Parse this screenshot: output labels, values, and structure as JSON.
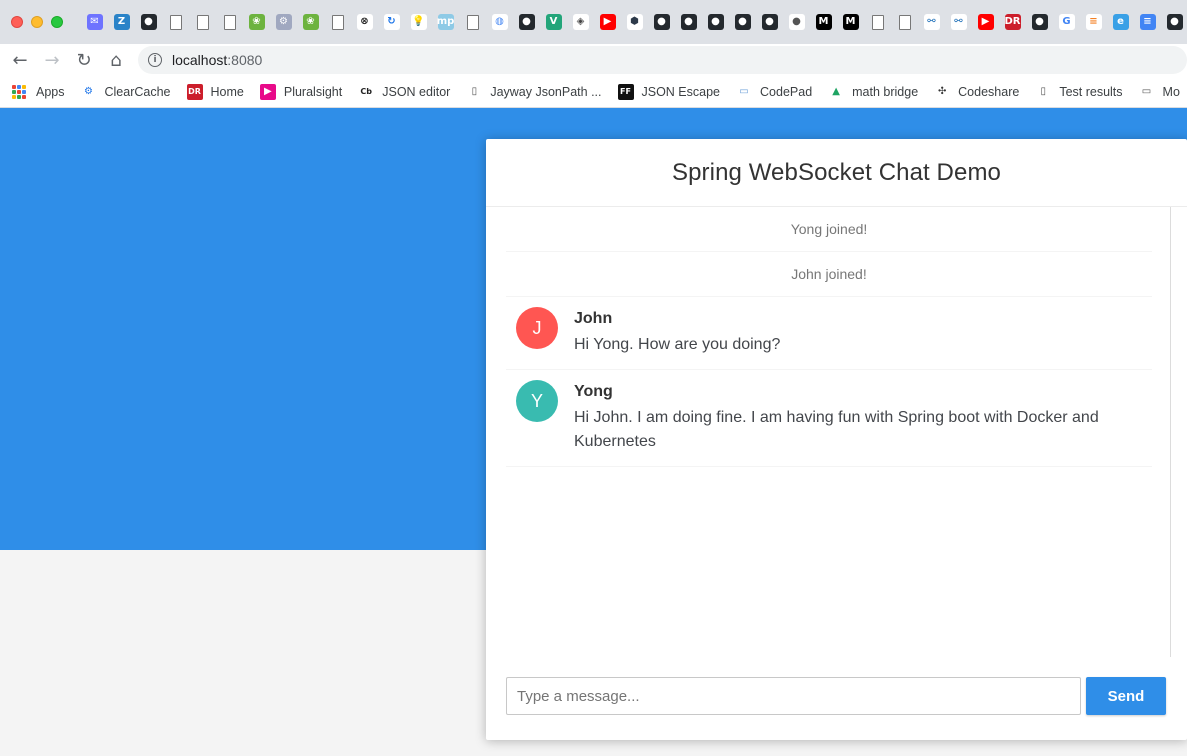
{
  "browser": {
    "url_host": "localhost",
    "url_port": ":8080",
    "pinned_tabs": [
      {
        "icon": "mail-icon",
        "glyph": "✉",
        "color": "#6e73ff",
        "fg": "#fff"
      },
      {
        "icon": "zotero-icon",
        "glyph": "Z",
        "color": "#2a83c8",
        "fg": "#fff"
      },
      {
        "icon": "github-icon",
        "glyph": "●",
        "color": "#24292e",
        "fg": "#fff"
      },
      {
        "icon": "page-icon",
        "glyph": "",
        "color": "#ffffff",
        "fg": "#555"
      },
      {
        "icon": "page-icon",
        "glyph": "",
        "color": "#ffffff",
        "fg": "#555"
      },
      {
        "icon": "page-icon",
        "glyph": "",
        "color": "#ffffff",
        "fg": "#555"
      },
      {
        "icon": "spring-icon",
        "glyph": "❀",
        "color": "#6db33f",
        "fg": "#fff"
      },
      {
        "icon": "settings-icon",
        "glyph": "⚙",
        "color": "#a0a8c0",
        "fg": "#fff"
      },
      {
        "icon": "spring-icon",
        "glyph": "❀",
        "color": "#6db33f",
        "fg": "#fff"
      },
      {
        "icon": "page-icon",
        "glyph": "",
        "color": "#ffffff",
        "fg": "#555"
      },
      {
        "icon": "close-circle-icon",
        "glyph": "⊗",
        "color": "#ffffff",
        "fg": "#222"
      },
      {
        "icon": "refresh-icon",
        "glyph": "↻",
        "color": "#ffffff",
        "fg": "#1a73e8"
      },
      {
        "icon": "bulb-icon",
        "glyph": "💡",
        "color": "#ffffff",
        "fg": "#f5b400"
      },
      {
        "icon": "mp-icon",
        "glyph": "mp",
        "color": "#8ecae6",
        "fg": "#fff"
      },
      {
        "icon": "page-icon",
        "glyph": "",
        "color": "#ffffff",
        "fg": "#555"
      },
      {
        "icon": "globe-icon",
        "glyph": "◍",
        "color": "#ffffff",
        "fg": "#4a8af4"
      },
      {
        "icon": "github-icon",
        "glyph": "●",
        "color": "#24292e",
        "fg": "#fff"
      },
      {
        "icon": "vue-icon",
        "glyph": "V",
        "color": "#23a57a",
        "fg": "#fff"
      },
      {
        "icon": "diamond-icon",
        "glyph": "◈",
        "color": "#ffffff",
        "fg": "#444"
      },
      {
        "icon": "youtube-icon",
        "glyph": "▶",
        "color": "#ff0000",
        "fg": "#fff"
      },
      {
        "icon": "hexagon-icon",
        "glyph": "⬢",
        "color": "#ffffff",
        "fg": "#2d3a4a"
      },
      {
        "icon": "github-icon",
        "glyph": "●",
        "color": "#24292e",
        "fg": "#fff"
      },
      {
        "icon": "github-icon",
        "glyph": "●",
        "color": "#24292e",
        "fg": "#fff"
      },
      {
        "icon": "github-icon",
        "glyph": "●",
        "color": "#24292e",
        "fg": "#fff"
      },
      {
        "icon": "github-icon",
        "glyph": "●",
        "color": "#24292e",
        "fg": "#fff"
      },
      {
        "icon": "github-icon",
        "glyph": "●",
        "color": "#24292e",
        "fg": "#fff"
      },
      {
        "icon": "apple-icon",
        "glyph": "●",
        "color": "#ffffff",
        "fg": "#555"
      },
      {
        "icon": "medium-icon",
        "glyph": "M",
        "color": "#000000",
        "fg": "#fff"
      },
      {
        "icon": "medium-icon",
        "glyph": "M",
        "color": "#000000",
        "fg": "#fff"
      },
      {
        "icon": "page-icon",
        "glyph": "",
        "color": "#ffffff",
        "fg": "#555"
      },
      {
        "icon": "page-icon",
        "glyph": "",
        "color": "#ffffff",
        "fg": "#555"
      },
      {
        "icon": "link-icon",
        "glyph": "⚯",
        "color": "#ffffff",
        "fg": "#1e6fb8"
      },
      {
        "icon": "link-icon",
        "glyph": "⚯",
        "color": "#ffffff",
        "fg": "#1e6fb8"
      },
      {
        "icon": "youtube-icon",
        "glyph": "▶",
        "color": "#ff0000",
        "fg": "#fff"
      },
      {
        "icon": "dr-icon",
        "glyph": "DR",
        "color": "#cc1e2b",
        "fg": "#fff"
      },
      {
        "icon": "github-icon",
        "glyph": "●",
        "color": "#24292e",
        "fg": "#fff"
      },
      {
        "icon": "google-icon",
        "glyph": "G",
        "color": "#ffffff",
        "fg": "#4285f4"
      },
      {
        "icon": "stackoverflow-icon",
        "glyph": "≡",
        "color": "#ffffff",
        "fg": "#f48024"
      },
      {
        "icon": "edge-icon",
        "glyph": "e",
        "color": "#39a0e6",
        "fg": "#fff"
      },
      {
        "icon": "docs-icon",
        "glyph": "≡",
        "color": "#4285f4",
        "fg": "#fff"
      },
      {
        "icon": "github-icon",
        "glyph": "●",
        "color": "#24292e",
        "fg": "#fff"
      },
      {
        "icon": "google-icon",
        "glyph": "G",
        "color": "#ffffff",
        "fg": "#4285f4"
      }
    ],
    "bookmarks": [
      {
        "label": "Apps",
        "icon": "apps-grid-icon"
      },
      {
        "label": "ClearCache",
        "icon": "gear-icon",
        "glyph": "⚙",
        "fg": "#1a73e8",
        "bg": "transparent"
      },
      {
        "label": "Home",
        "icon": "dr-icon",
        "glyph": "DR",
        "fg": "#fff",
        "bg": "#cc1e2b"
      },
      {
        "label": "Pluralsight",
        "icon": "pluralsight-icon",
        "glyph": "▶",
        "fg": "#fff",
        "bg": "#e80a89"
      },
      {
        "label": "JSON editor",
        "icon": "cb-icon",
        "glyph": "Cb",
        "fg": "#222",
        "bg": "transparent"
      },
      {
        "label": "Jayway JsonPath ...",
        "icon": "page-icon",
        "glyph": "▯",
        "fg": "#555",
        "bg": "transparent"
      },
      {
        "label": "JSON Escape",
        "icon": "ff-icon",
        "glyph": "FF",
        "fg": "#fff",
        "bg": "#111"
      },
      {
        "label": "CodePad",
        "icon": "codepad-icon",
        "glyph": "▭",
        "fg": "#6ea0d8",
        "bg": "transparent"
      },
      {
        "label": "math bridge",
        "icon": "drive-icon",
        "glyph": "▲",
        "fg": "#1fa463",
        "bg": "transparent"
      },
      {
        "label": "Codeshare",
        "icon": "codeshare-icon",
        "glyph": "✣",
        "fg": "#333",
        "bg": "transparent"
      },
      {
        "label": "Test results",
        "icon": "page-icon",
        "glyph": "▯",
        "fg": "#555",
        "bg": "transparent"
      },
      {
        "label": "Mo",
        "icon": "folder-icon",
        "glyph": "▭",
        "fg": "#555",
        "bg": "transparent"
      }
    ]
  },
  "chat": {
    "title": "Spring WebSocket Chat Demo",
    "events": [
      {
        "text": "Yong joined!"
      },
      {
        "text": "John joined!"
      }
    ],
    "messages": [
      {
        "initial": "J",
        "sender": "John",
        "text": "Hi Yong. How are you doing?",
        "avatar_color": "#ff5652"
      },
      {
        "initial": "Y",
        "sender": "Yong",
        "text": "Hi John. I am doing fine. I am having fun with Spring boot with Docker and Kubernetes",
        "avatar_color": "#39bbb0"
      }
    ],
    "input_placeholder": "Type a message...",
    "send_label": "Send"
  },
  "colors": {
    "hero": "#2f8ee8",
    "page_background": "#f4f4f4"
  }
}
